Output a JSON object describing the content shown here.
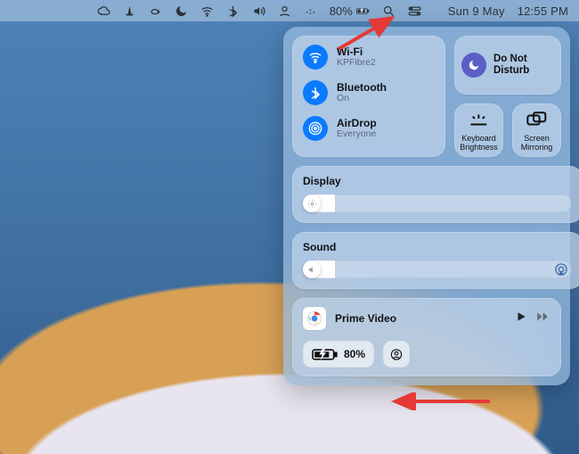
{
  "menubar": {
    "battery_pct": "80%",
    "date": "Sun 9 May",
    "time": "12:55 PM"
  },
  "cc": {
    "wifi": {
      "title": "Wi-Fi",
      "sub": "KPFibre2"
    },
    "bt": {
      "title": "Bluetooth",
      "sub": "On"
    },
    "airdrop": {
      "title": "AirDrop",
      "sub": "Everyone"
    },
    "dnd": {
      "title": "Do Not Disturb"
    },
    "kb": {
      "label": "Keyboard Brightness"
    },
    "mirror": {
      "label": "Screen Mirroring"
    },
    "display": {
      "title": "Display"
    },
    "sound": {
      "title": "Sound"
    },
    "media": {
      "app": "Prime Video"
    },
    "battery": {
      "pct": "80%"
    }
  }
}
